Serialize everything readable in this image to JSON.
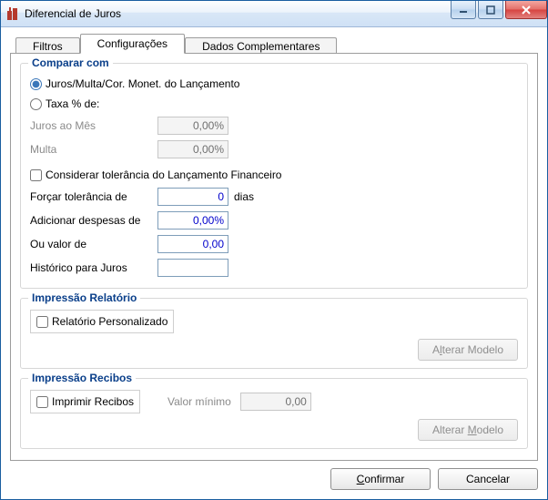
{
  "window": {
    "title": "Diferencial de Juros"
  },
  "tabs": {
    "filtros": "Filtros",
    "configuracoes": "Configurações",
    "dados": "Dados Complementares"
  },
  "comparar": {
    "legend": "Comparar com",
    "opt_juros_multa": "Juros/Multa/Cor. Monet. do Lançamento",
    "opt_taxa": "Taxa % de:",
    "juros_mes_label": "Juros ao Mês",
    "juros_mes_value": "0,00%",
    "multa_label": "Multa",
    "multa_value": "0,00%",
    "considerar_tolerancia": "Considerar tolerância do Lançamento Financeiro",
    "forcar_tolerancia_label": "Forçar tolerância de",
    "forcar_tolerancia_value": "0",
    "dias": "dias",
    "adicionar_despesas_label": "Adicionar  despesas de",
    "adicionar_despesas_value": "0,00%",
    "ou_valor_label": "Ou valor de",
    "ou_valor_value": "0,00",
    "historico_label": "Histórico para Juros",
    "historico_value": ""
  },
  "relatorio": {
    "legend": "Impressão Relatório",
    "chk_personalizado": "Relatório Personalizado",
    "alterar_pre": "A",
    "alterar_ul": "l",
    "alterar_post": "terar Modelo"
  },
  "recibos": {
    "legend": "Impressão Recibos",
    "chk_imprimir": "Imprimir Recibos",
    "valor_minimo_label": "Valor mínimo",
    "valor_minimo_value": "0,00",
    "alterar_pre": "Alterar ",
    "alterar_ul": "M",
    "alterar_post": "odelo"
  },
  "actions": {
    "confirmar_ul": "C",
    "confirmar_post": "onfirmar",
    "cancelar": "Cancelar"
  }
}
